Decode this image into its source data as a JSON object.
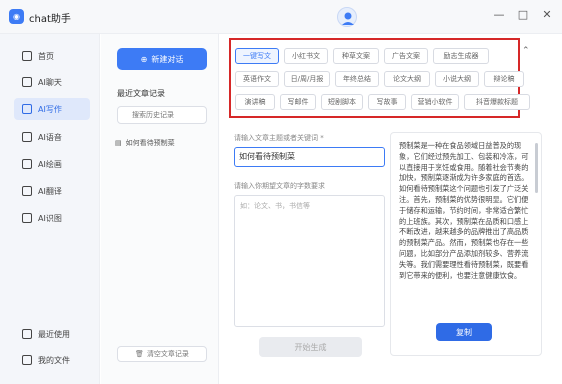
{
  "app": {
    "title": "chat助手",
    "logo_glyph": "◉"
  },
  "window": {
    "minimize": "—",
    "maximize": "□",
    "close": "✕"
  },
  "sidebar": {
    "items": [
      {
        "label": "首页",
        "icon": "home-icon",
        "active": false
      },
      {
        "label": "AI聊天",
        "icon": "chat-icon",
        "active": false
      },
      {
        "label": "AI写作",
        "icon": "write-icon",
        "active": true
      },
      {
        "label": "AI语音",
        "icon": "voice-icon",
        "active": false
      },
      {
        "label": "AI绘画",
        "icon": "paint-icon",
        "active": false
      },
      {
        "label": "AI翻译",
        "icon": "translate-icon",
        "active": false
      },
      {
        "label": "AI识图",
        "icon": "image-icon",
        "active": false
      }
    ],
    "bottom": [
      {
        "label": "最近使用",
        "icon": "recent-icon"
      },
      {
        "label": "我的文件",
        "icon": "file-icon"
      }
    ]
  },
  "history": {
    "new_button": "新建对话",
    "title": "最近文章记录",
    "search_placeholder": "搜索历史记录",
    "items": [
      {
        "label": "如何看待预制菜"
      }
    ],
    "clear_button": "清空文章记录"
  },
  "tags": {
    "rows": [
      [
        "一键写文",
        "小红书文",
        "种草文案",
        "广告文案",
        "励志生成器"
      ],
      [
        "英语作文",
        "日/周/月报",
        "年终总结",
        "论文大纲",
        "小说大纲",
        "辩论稿"
      ],
      [
        "演讲稿",
        "写邮件",
        "短剧脚本",
        "写故事",
        "营销小软件",
        "抖音爆款标题"
      ]
    ],
    "active": "一键写文"
  },
  "form": {
    "topic_label": "请输入文章主题或者关键词 *",
    "topic_value": "如何看待预制菜",
    "req_label": "请输入你期望文章的字数要求",
    "req_placeholder": "如：论文、书，书信等",
    "generate_button": "开始生成"
  },
  "result": {
    "text": "预制菜是一种在食品领域日益普及的现象，它们经过预先加工、包装和冷冻，可以直接用于烹饪或食用。随着社会节奏的加快，预制菜逐渐成为许多家庭的首选。如何看待预制菜这个问题也引发了广泛关注。首先，预制菜的优势很明显。它们便于储存和运输，节约时间，非常适合繁忙的上班族。其次，预制菜在品质和口感上不断改进，越来越多的品牌推出了高品质的预制菜产品。然而，预制菜也存在一些问题，比如部分产品添加剂较多、营养流失等。我们需要理性看待预制菜，既要看到它带来的便利，也要注意健康饮食。",
    "copy_button": "复制"
  },
  "colors": {
    "accent": "#3d7bf5",
    "highlight": "#d62828"
  }
}
